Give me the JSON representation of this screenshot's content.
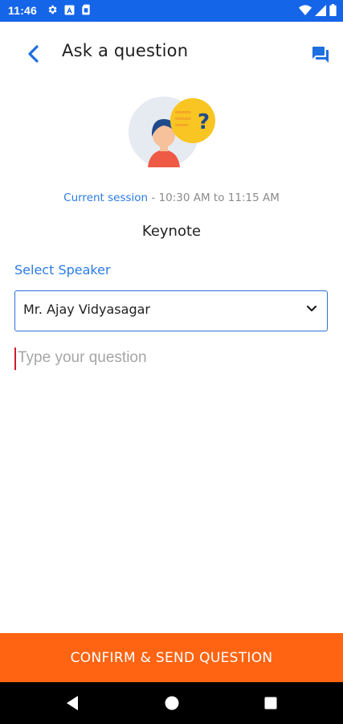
{
  "status_bar": {
    "time": "11:46",
    "icons_left": [
      "gear-icon",
      "text-a-icon",
      "sim-card-icon"
    ],
    "icons_right": [
      "wifi-icon",
      "signal-icon",
      "battery-icon"
    ],
    "color": "#1565e8"
  },
  "header": {
    "title": "Ask a question",
    "back_icon": "chevron-left-icon",
    "action_icon": "chat-bubbles-icon",
    "accent": "#1e6fe0"
  },
  "illustration": {
    "icon": "person-with-question-bubble-icon"
  },
  "session": {
    "label": "Current session",
    "time": " - 10:30 AM to 11:15 AM",
    "name": "Keynote"
  },
  "speaker": {
    "label": "Select Speaker",
    "selected": "Mr. Ajay Vidyasagar"
  },
  "question": {
    "placeholder": "Type your question",
    "value": ""
  },
  "footer": {
    "confirm_label": "CONFIRM & SEND QUESTION",
    "color": "#ff6412"
  },
  "nav": {
    "icons": [
      "back-triangle-icon",
      "home-circle-icon",
      "recents-square-icon"
    ]
  }
}
